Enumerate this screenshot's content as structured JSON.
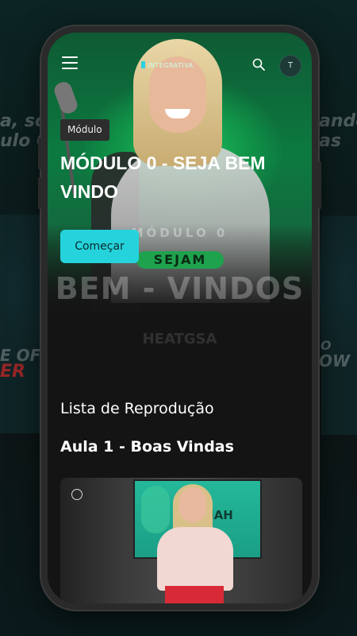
{
  "app": {
    "logo_text": "INTEGRATIVA"
  },
  "header": {
    "menu_icon": "hamburger-menu-icon",
    "search_icon": "search-icon",
    "avatar_initial": "T"
  },
  "hero": {
    "tag": "Módulo",
    "title": "MÓDULO 0 - SEJA BEM VINDO",
    "cta_label": "Começar",
    "banner_module": "MÓDULO 0",
    "banner_sejam": "SEJAM",
    "banner_bem_vindos": "BEM - VINDOS",
    "banner_brand": "HEATGSA"
  },
  "playlist": {
    "section_title": "Lista de Reprodução",
    "lesson_title": "Aula 1 - Boas Vindas",
    "thumbnail_text": "R MAH"
  },
  "background": {
    "left_text_1": "a, sou",
    "left_text_2": "ulo Co",
    "left_text_3": "E OF",
    "left_text_4": "ER",
    "right_text_1": "ando",
    "right_text_2": "as",
    "right_text_3": "O",
    "right_text_4": "OW"
  },
  "colors": {
    "accent": "#25d3dc",
    "hero_green": "#129a4a",
    "surface": "#141414"
  }
}
